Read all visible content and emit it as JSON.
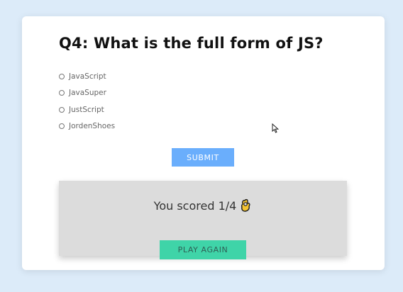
{
  "quiz": {
    "question": "Q4: What is the full form of JS?",
    "options": [
      "JavaScript",
      "JavaSuper",
      "JustScript",
      "JordenShoes"
    ],
    "submit_label": "SUBMIT"
  },
  "result": {
    "score_text": "You scored 1/4",
    "emoji_icon": "ok-hand-icon",
    "play_again_label": "PLAY AGAIN"
  },
  "colors": {
    "background": "#dcebf9",
    "submit_button": "#6aaefc",
    "play_again_button": "#3fd4a8",
    "score_panel": "#dcdcdc"
  }
}
